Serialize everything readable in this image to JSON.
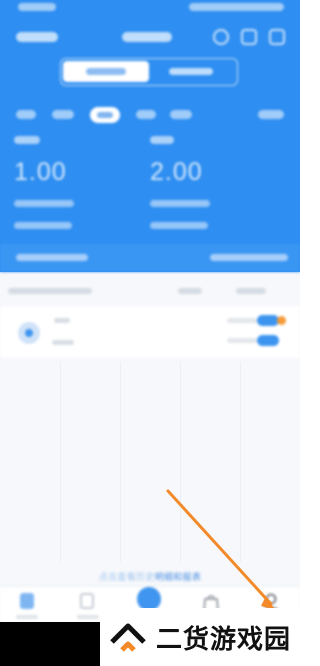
{
  "stats": {
    "left_value": "1.00",
    "right_value": "2.00"
  },
  "footer": {
    "link_text_faded": "点击查看历史",
    "link_text": "明细和报表"
  },
  "watermark": {
    "brand_text": "二货游戏园"
  },
  "colors": {
    "primary_blue": "#2e8ef1",
    "annotation_orange": "#f28a2a"
  },
  "icons": {
    "header_left": "search-icon",
    "header_mid": "grid-icon",
    "header_right": "menu-icon",
    "tab_1": "home-icon",
    "tab_2": "clipboard-icon",
    "tab_3": "add-icon",
    "tab_4": "shopping-bag-icon",
    "tab_5": "user-icon"
  }
}
